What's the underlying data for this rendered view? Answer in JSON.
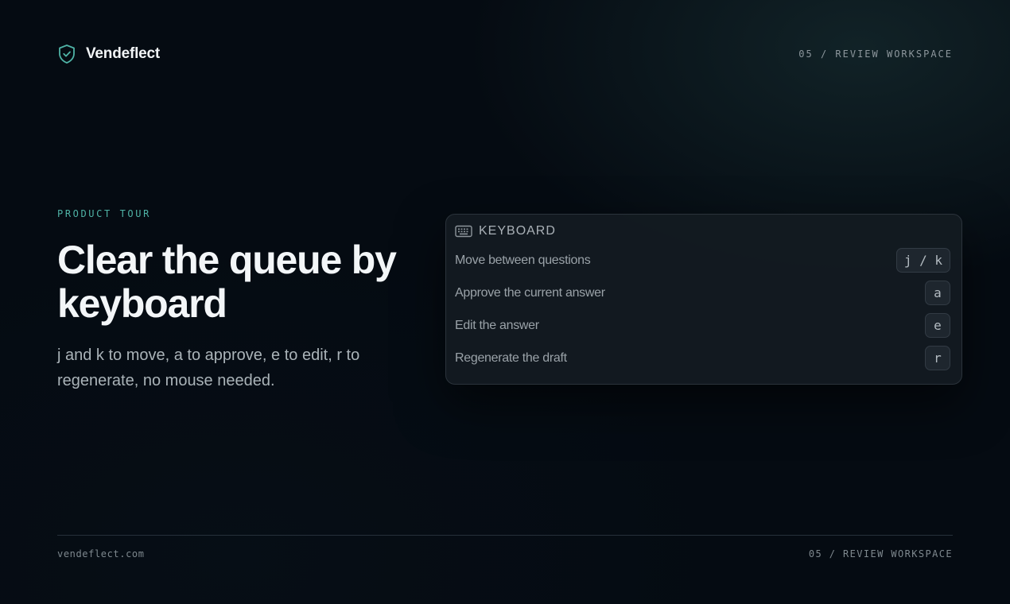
{
  "brand": {
    "name": "Vendeflect",
    "icon": "shield-check-icon",
    "accent": "#4fb3a6"
  },
  "header": {
    "section": "05 / REVIEW WORKSPACE"
  },
  "hero": {
    "eyebrow": "PRODUCT TOUR",
    "title": "Clear the queue by keyboard",
    "subtitle": "j and k to move, a to approve, e to edit, r to regenerate, no mouse needed."
  },
  "panel": {
    "icon": "keyboard-icon",
    "title": "KEYBOARD",
    "rows": [
      {
        "label": "Move between questions",
        "keys": "j / k"
      },
      {
        "label": "Approve the current answer",
        "keys": "a"
      },
      {
        "label": "Edit the answer",
        "keys": "e"
      },
      {
        "label": "Regenerate the draft",
        "keys": "r"
      }
    ]
  },
  "footer": {
    "site": "vendeflect.com",
    "section": "05 / REVIEW WORKSPACE"
  }
}
